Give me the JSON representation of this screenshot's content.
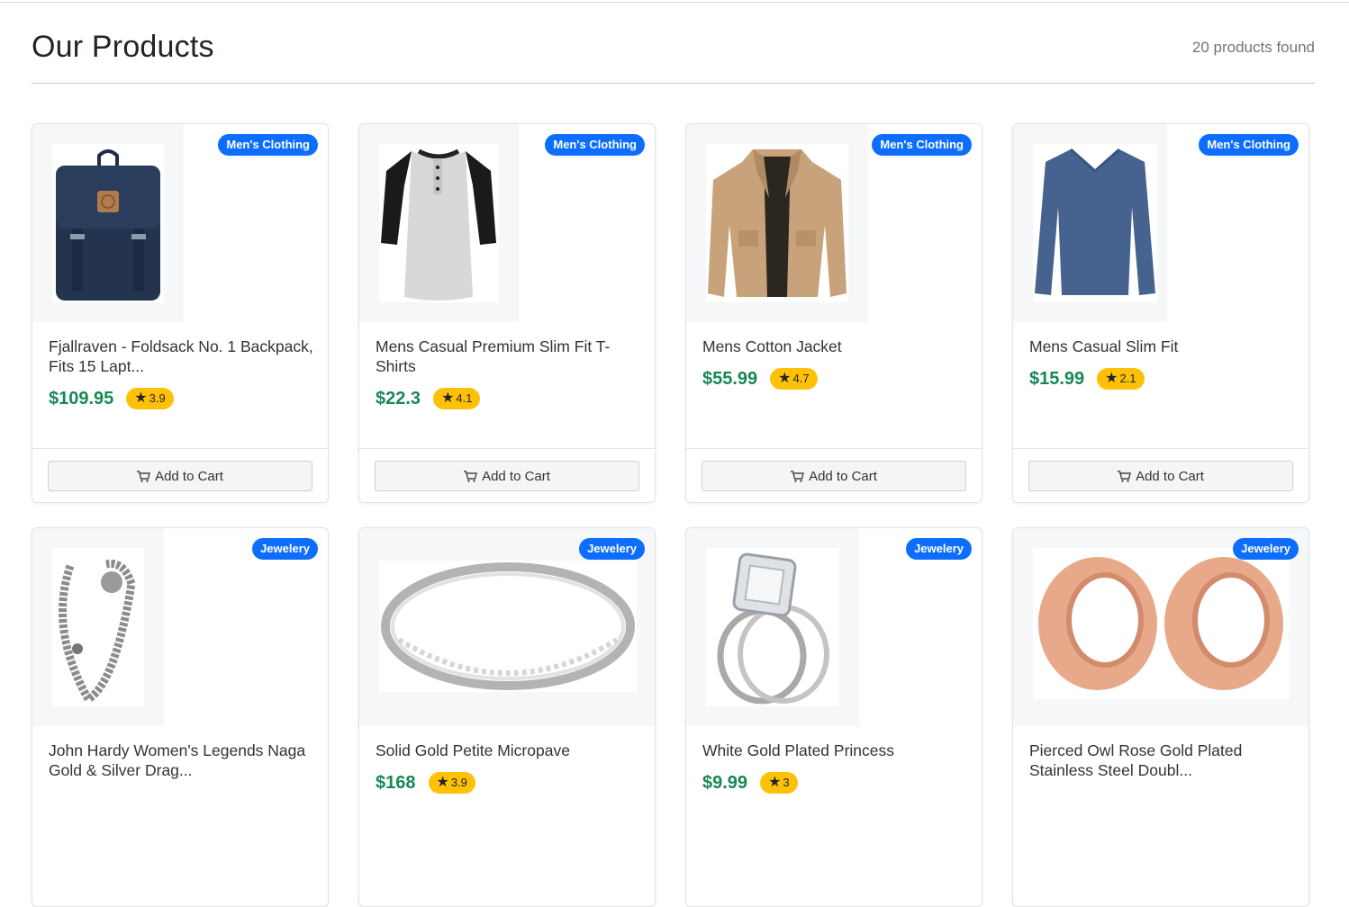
{
  "header": {
    "title": "Our Products",
    "count": "20 products found"
  },
  "cart_label": "Add to Cart",
  "products": [
    {
      "category": "Men's Clothing",
      "title": "Fjallraven - Foldsack No. 1 Backpack, Fits 15 Lapt...",
      "price": "$109.95",
      "rating": "3.9",
      "image_icon": "backpack"
    },
    {
      "category": "Men's Clothing",
      "title": "Mens Casual Premium Slim Fit T-Shirts",
      "price": "$22.3",
      "rating": "4.1",
      "image_icon": "raglan-shirt"
    },
    {
      "category": "Men's Clothing",
      "title": "Mens Cotton Jacket",
      "price": "$55.99",
      "rating": "4.7",
      "image_icon": "jacket"
    },
    {
      "category": "Men's Clothing",
      "title": "Mens Casual Slim Fit",
      "price": "$15.99",
      "rating": "2.1",
      "image_icon": "long-sleeve-shirt"
    },
    {
      "category": "Jewelery",
      "title": "John Hardy Women's Legends Naga Gold & Silver Drag...",
      "price": "",
      "rating": "",
      "image_icon": "bracelet"
    },
    {
      "category": "Jewelery",
      "title": "Solid Gold Petite Micropave",
      "price": "$168",
      "rating": "3.9",
      "image_icon": "ring-band"
    },
    {
      "category": "Jewelery",
      "title": "White Gold Plated Princess",
      "price": "$9.99",
      "rating": "3",
      "image_icon": "diamond-ring"
    },
    {
      "category": "Jewelery",
      "title": "Pierced Owl Rose Gold Plated Stainless Steel Doubl...",
      "price": "",
      "rating": "",
      "image_icon": "ear-tunnels"
    }
  ]
}
